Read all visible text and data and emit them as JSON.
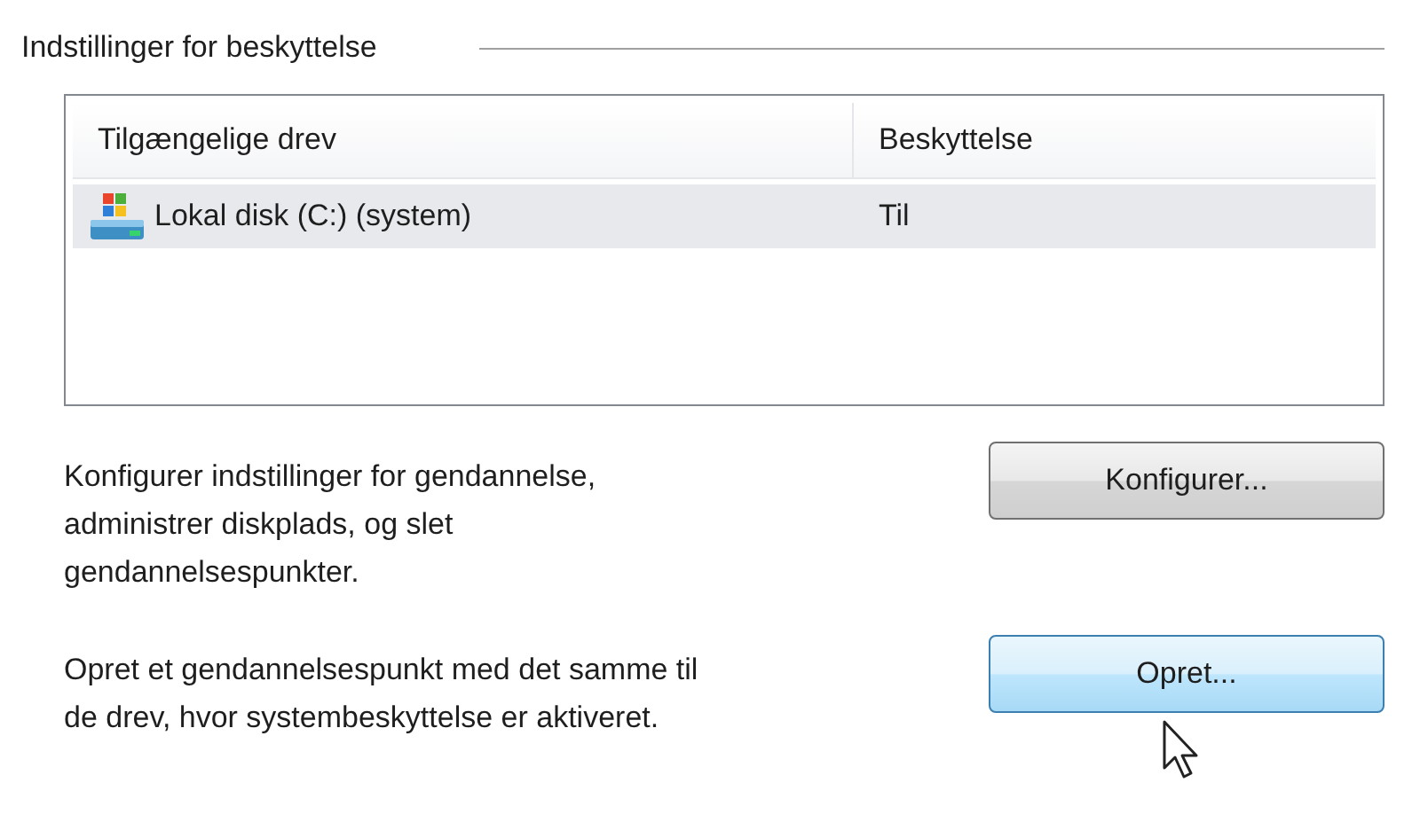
{
  "group": {
    "title": "Indstillinger for beskyttelse"
  },
  "table": {
    "columns": [
      "Tilgængelige drev",
      "Beskyttelse"
    ],
    "rows": [
      {
        "drive": "Lokal disk (C:) (system)",
        "protection": "Til",
        "selected": true
      }
    ]
  },
  "actions": [
    {
      "description": "Konfigurer indstillinger for gendannelse,\nadministrer diskplads, og slet\ngendannelsespunkter.",
      "button": "Konfigurer...",
      "hovered": false
    },
    {
      "description": "Opret et gendannelsespunkt med det samme til\nde drev, hvor systembeskyttelse er aktiveret.",
      "button": "Opret...",
      "hovered": true
    }
  ]
}
